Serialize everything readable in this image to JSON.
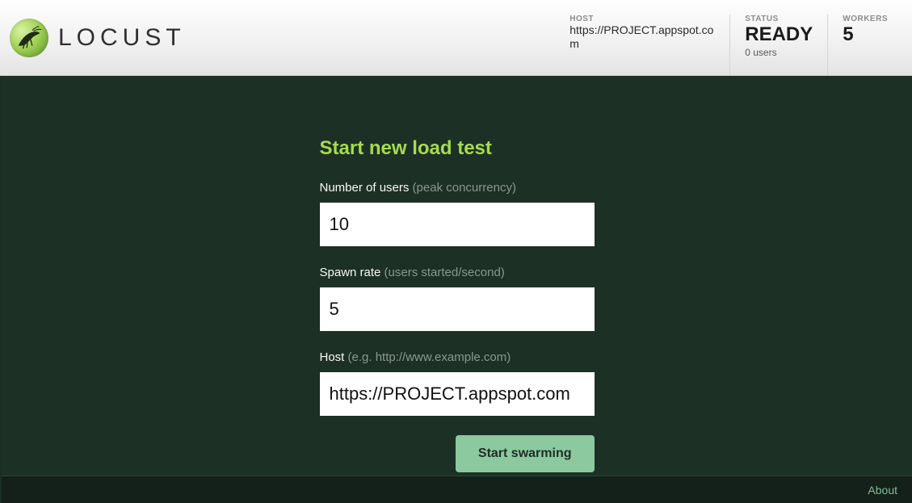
{
  "logo": {
    "name": "LOCUST"
  },
  "header": {
    "host": {
      "label": "HOST",
      "value": "https://PROJECT.appspot.com"
    },
    "status": {
      "label": "STATUS",
      "value": "READY",
      "sub": "0 users"
    },
    "workers": {
      "label": "WORKERS",
      "value": "5"
    }
  },
  "form": {
    "title": "Start new load test",
    "users": {
      "label": "Number of users ",
      "hint": "(peak concurrency)",
      "value": "10"
    },
    "spawn": {
      "label": "Spawn rate ",
      "hint": "(users started/second)",
      "value": "5"
    },
    "host": {
      "label": "Host ",
      "hint": "(e.g. http://www.example.com)",
      "value": "https://PROJECT.appspot.com"
    },
    "submit": "Start swarming"
  },
  "footer": {
    "about": "About"
  }
}
